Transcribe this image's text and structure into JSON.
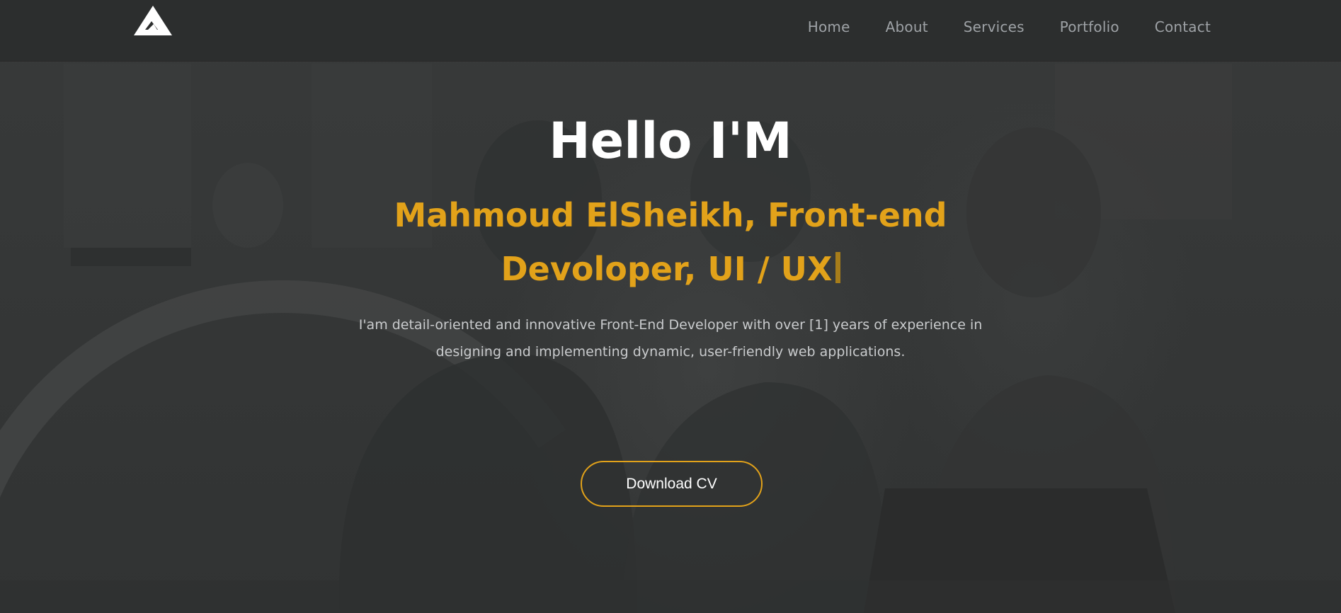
{
  "nav": {
    "logo_icon": "triangle-logo-icon",
    "links": [
      {
        "label": "Home"
      },
      {
        "label": "About"
      },
      {
        "label": "Services"
      },
      {
        "label": "Portfolio"
      },
      {
        "label": "Contact"
      }
    ]
  },
  "hero": {
    "greeting": "Hello I'M",
    "role": "Mahmoud ElSheikh, Front-end Devoloper, UI / UX",
    "description": "I'am detail-oriented and innovative Front-End Developer with over [1] years of experience in designing and implementing dynamic, user-friendly web applications.",
    "cta_label": "Download CV"
  },
  "colors": {
    "accent": "#e2a21a",
    "navbar_bg": "#2c2e2e",
    "nav_text": "#9ea2a6",
    "page_bg": "#353737"
  }
}
